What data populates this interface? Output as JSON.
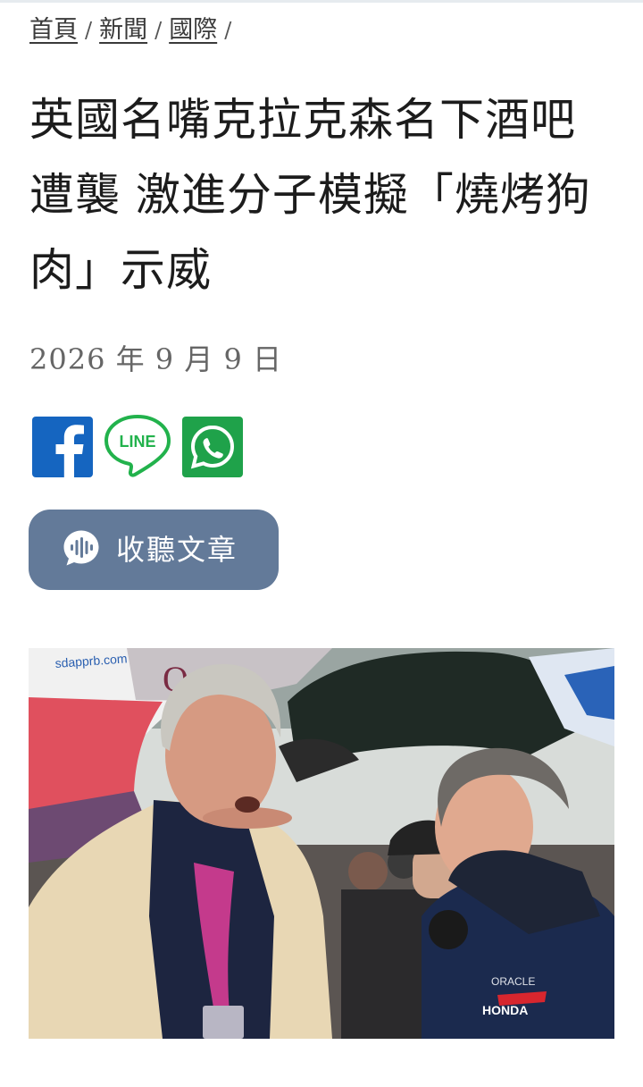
{
  "breadcrumb": {
    "items": [
      "首頁",
      "新聞",
      "國際"
    ],
    "separator": "/"
  },
  "article": {
    "title": "英國名嘴克拉克森名下酒吧遭襲 激進分子模擬「燒烤狗肉」示威",
    "date": "2026 年 9 月 9 日"
  },
  "share": {
    "facebook_icon": "facebook-icon",
    "line_icon": "line-icon",
    "line_label": "LINE",
    "whatsapp_icon": "whatsapp-icon",
    "colors": {
      "facebook": "#1565c0",
      "line": "#22b24c",
      "whatsapp": "#1fa24a"
    }
  },
  "listen": {
    "label": "收聽文章",
    "icon": "audio-wave-icon",
    "color": "#637a99"
  },
  "photo": {
    "umbrella_text": "Qatar",
    "sign_text": "ORACLE",
    "jacket_text": "HONDA",
    "url_text": "sdapprb.com"
  }
}
